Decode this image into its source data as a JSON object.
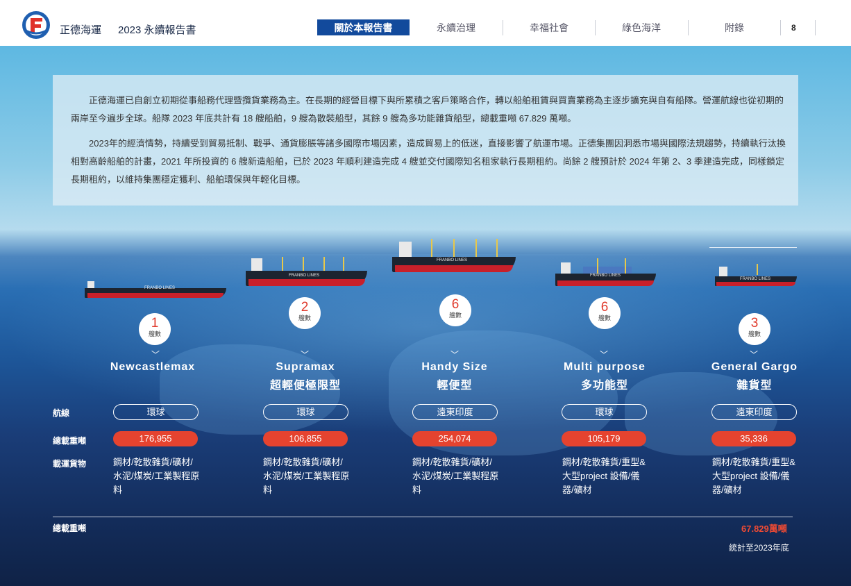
{
  "header": {
    "brand": "正德海運",
    "report_title": "2023 永續報告書",
    "logo_text": "FRANBO LINES",
    "nav": [
      "關於本報告書",
      "永續治理",
      "幸福社會",
      "綠色海洋",
      "附錄"
    ],
    "active_nav": "關於本報告書",
    "page_number": "8"
  },
  "intro": {
    "para1": "正德海運已自創立初期從事船務代理暨攬貨業務為主。在長期的經營目標下與所累積之客戶策略合作，轉以船舶租賃與買賣業務為主逐步擴充與自有船隊。營運航線也從初期的兩岸至今遍步全球。船隊 2023 年底共計有 18 艘船舶，9 艘為散裝船型，其餘 9 艘為多功能雜貨船型，總載重噸 67.829 萬噸。",
    "para2": "2023年的經濟情勢，持續受到貿易抵制、戰爭、通貨膨脹等諸多國際市場因素，造成貿易上的低迷，直接影響了航運市場。正德集團因洞悉市場與國際法規趨勢，持續執行汰換相對高齡船舶的計畫，2021 年所投資的 6 艘新造船舶，已於 2023 年順利建造完成 4 艘並交付國際知名租家執行長期租約。尚餘 2 艘預計於 2024 年第 2、3 季建造完成，同樣鎖定長期租約，以維持集團穩定獲利、船舶環保與年輕化目標。"
  },
  "ship_label": "FRANBO LINES",
  "row_labels": {
    "route": "航線",
    "dwt": "總載重噸",
    "cargo": "載運貨物"
  },
  "count_unit": "艘數",
  "ships": [
    {
      "count": "1",
      "name_en": "Newcastlemax",
      "name_zh": "",
      "route": "環球",
      "dwt": "176,955",
      "cargo": "鋼材/乾散雜貨/礦材/水泥/煤炭/工業製程原料"
    },
    {
      "count": "2",
      "name_en": "Supramax",
      "name_zh": "超輕便極限型",
      "route": "環球",
      "dwt": "106,855",
      "cargo": "鋼材/乾散雜貨/礦材/水泥/煤炭/工業製程原料"
    },
    {
      "count": "6",
      "name_en": "Handy Size",
      "name_zh": "輕便型",
      "route": "遠東印度",
      "dwt": "254,074",
      "cargo": "鋼材/乾散雜貨/礦材/水泥/煤炭/工業製程原料"
    },
    {
      "count": "6",
      "name_en": "Multi purpose",
      "name_zh": "多功能型",
      "route": "環球",
      "dwt": "105,179",
      "cargo": "鋼材/乾散雜貨/重型&大型project 設備/儀器/礦材"
    },
    {
      "count": "3",
      "name_en": "General Gargo",
      "name_zh": "雜貨型",
      "route": "遠東印度",
      "dwt": "35,336",
      "cargo": "鋼材/乾散雜貨/重型&大型project 設備/儀器/礦材"
    }
  ],
  "total": {
    "label": "總載重噸",
    "value": "67.829萬噸",
    "note": "統計至2023年底"
  },
  "colors": {
    "nav_active": "#124a9c",
    "accent_red": "#e5432f",
    "total_red": "#ee4a33"
  }
}
